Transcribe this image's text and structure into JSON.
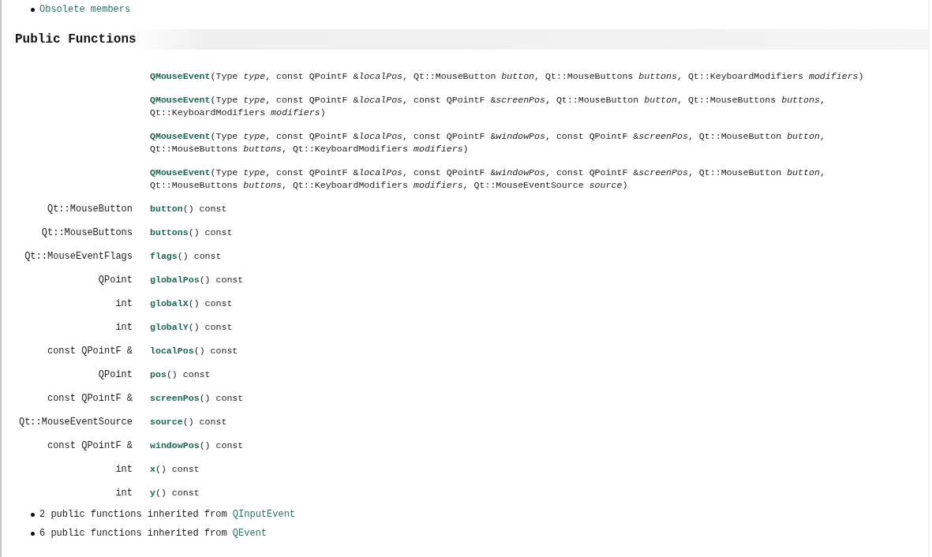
{
  "obsolete_link": "Obsolete members",
  "section_title": "Public Functions",
  "functions": [
    {
      "name": "QMouseEvent",
      "params": "(Type *type*, const QPointF &*localPos*, Qt::MouseButton *button*, Qt::MouseButtons *buttons*, Qt::KeyboardModifiers *modifiers*)"
    },
    {
      "name": "QMouseEvent",
      "params": "(Type *type*, const QPointF &*localPos*, const QPointF &*screenPos*, Qt::MouseButton *button*, Qt::MouseButtons *buttons*, Qt::KeyboardModifiers *modifiers*)"
    },
    {
      "name": "QMouseEvent",
      "params": "(Type *type*, const QPointF &*localPos*, const QPointF &*windowPos*, const QPointF &*screenPos*, Qt::MouseButton *button*, Qt::MouseButtons *buttons*, Qt::KeyboardModifiers *modifiers*)"
    },
    {
      "name": "QMouseEvent",
      "params": "(Type *type*, const QPointF &*localPos*, const QPointF &*windowPos*, const QPointF &*screenPos*, Qt::MouseButton *button*, Qt::MouseButtons *buttons*, Qt::KeyboardModifiers *modifiers*, Qt::MouseEventSource *source*)"
    },
    {
      "return_type": "Qt::MouseButton",
      "name": "button",
      "params": "() const"
    },
    {
      "return_type": "Qt::MouseButtons",
      "name": "buttons",
      "params": "() const"
    },
    {
      "return_type": "Qt::MouseEventFlags",
      "name": "flags",
      "params": "() const"
    },
    {
      "return_type": "QPoint",
      "name": "globalPos",
      "params": "() const"
    },
    {
      "return_type": "int",
      "name": "globalX",
      "params": "() const"
    },
    {
      "return_type": "int",
      "name": "globalY",
      "params": "() const"
    },
    {
      "return_type": "const QPointF &",
      "name": "localPos",
      "params": "() const"
    },
    {
      "return_type": "QPoint",
      "name": "pos",
      "params": "() const"
    },
    {
      "return_type": "const QPointF &",
      "name": "screenPos",
      "params": "() const"
    },
    {
      "return_type": "Qt::MouseEventSource",
      "name": "source",
      "params": "() const"
    },
    {
      "return_type": "const QPointF &",
      "name": "windowPos",
      "params": "() const"
    },
    {
      "return_type": "int",
      "name": "x",
      "params": "() const"
    },
    {
      "return_type": "int",
      "name": "y",
      "params": "() const"
    }
  ],
  "inherited": [
    {
      "text": "2 public functions inherited from",
      "link": "QInputEvent"
    },
    {
      "text": "6 public functions inherited from",
      "link": "QEvent"
    }
  ]
}
